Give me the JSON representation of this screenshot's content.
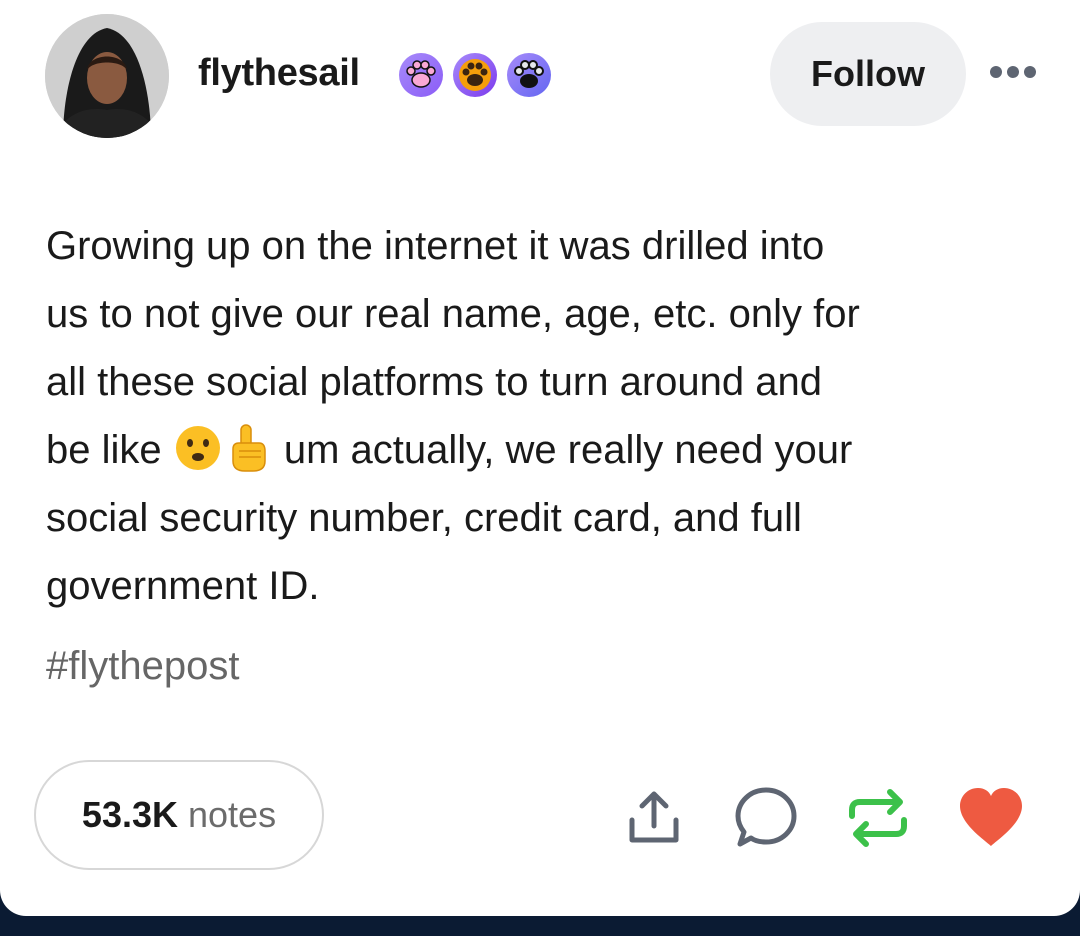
{
  "post": {
    "username": "flythesail",
    "follow_label": "Follow",
    "body_lines": [
      "Growing up on the internet it was drilled into",
      "us to not give our real name, age, etc. only for",
      "all these social platforms to turn around and",
      "um actually, we really need your",
      "social security number, credit card, and full",
      "government ID."
    ],
    "line4_prefix": "be like",
    "inline_emoji": [
      "frowning-face-emoji",
      "pointing-up-emoji"
    ],
    "hashtag": "#flythepost",
    "badges": [
      "pink-paw-badge",
      "orange-paw-badge",
      "black-paw-badge"
    ]
  },
  "footer": {
    "notes_count": "53.3K",
    "notes_label": "notes",
    "actions": [
      "share-icon",
      "reply-icon",
      "reblog-icon",
      "like-icon"
    ]
  },
  "colors": {
    "like": "#ee5a41",
    "reblog": "#3cc14a",
    "icon_gray": "#5e6572",
    "follow_bg": "#eeeff1",
    "page_bg": "#0b1b33"
  }
}
